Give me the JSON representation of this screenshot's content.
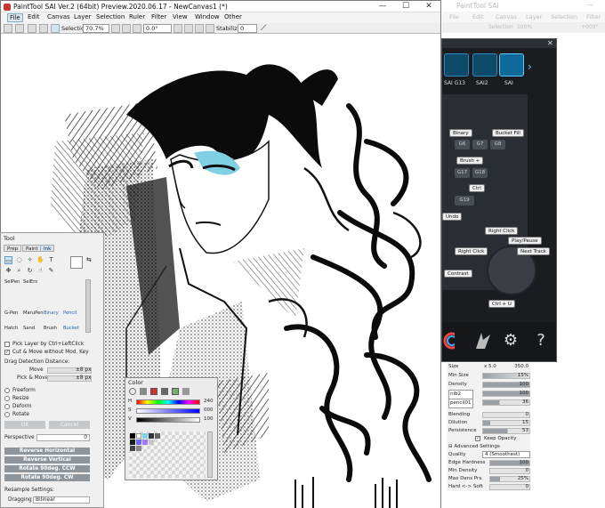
{
  "main_window": {
    "title": "PaintTool SAI Ver.2 (64bit) Preview.2020.06.17 - NewCanvas1 (*)",
    "minimize": "—",
    "maximize": "☐",
    "close": "✕"
  },
  "menu": [
    "File",
    "Edit",
    "Canvas",
    "Layer",
    "Selection",
    "Ruler",
    "Filter",
    "View",
    "Window",
    "Other"
  ],
  "toolbar": {
    "selection_label": "Selection",
    "zoom": "70.7%",
    "rotation": "0.0°",
    "stabilizer_label": "Stabilizer",
    "stabilizer_value": "0"
  },
  "right_ghost": {
    "title": "PaintTool SAI",
    "menu": [
      "File",
      "Edit",
      "Canvas",
      "Layer",
      "Selection",
      "Filter"
    ],
    "selection": "Selection",
    "zoom": "100%",
    "rotation": "+000°"
  },
  "game_panel": {
    "profiles": [
      "SAI G13",
      "SAI2",
      "SAI"
    ],
    "keys": [
      {
        "label": "Binary"
      },
      {
        "label": "Bucket Fill"
      },
      {
        "label": "G6"
      },
      {
        "label": "G7"
      },
      {
        "label": "G8"
      },
      {
        "label": "Brush +"
      },
      {
        "label": "G17"
      },
      {
        "label": "G18"
      },
      {
        "label": "Ctrl"
      },
      {
        "label": "G19"
      },
      {
        "label": "Undo"
      }
    ],
    "stick_labels": {
      "up": "Right Click",
      "play": "Play/Pause",
      "left": "Right Click",
      "right": "Next Track",
      "contrast": "Contrast",
      "down": "Ctrl + U"
    },
    "footer_icons": [
      "color-wheel-icon",
      "logo-icon",
      "gear-icon",
      "help-icon"
    ],
    "help_glyph": "?",
    "gear_glyph": "⚙"
  },
  "brush_settings": {
    "size": {
      "label": "Size",
      "mult": "x 5.0",
      "value": "350.0"
    },
    "min_size": {
      "label": "Min Size",
      "value": "15%"
    },
    "density": {
      "label": "Density",
      "value": "100"
    },
    "shape1": {
      "label": "nib2",
      "value": "100"
    },
    "shape2": {
      "label": "pencil01",
      "value": "36"
    },
    "blending": {
      "label": "Blending",
      "value": "0"
    },
    "dilution": {
      "label": "Dilution",
      "value": "15"
    },
    "persistence": {
      "label": "Persistence",
      "value": "53"
    },
    "keep_opacity": "Keep Opacity",
    "advanced": "Advanced Settings",
    "quality": {
      "label": "Quality",
      "value": "4 (Smoothest)"
    },
    "edge_hardness": {
      "label": "Edge Hardness",
      "value": "100"
    },
    "min_density": {
      "label": "Min Density",
      "value": "0"
    },
    "max_dens_prs": {
      "label": "Max Dens Prs.",
      "value": "25%"
    },
    "hard_soft": {
      "label": "Hard <-> Soft",
      "value": "0"
    }
  },
  "tool_panel": {
    "title": "Tool",
    "tabs": [
      "Prep",
      "Paint",
      "Ink"
    ],
    "brushes_row1": [
      "SelPen",
      "SelErs"
    ],
    "brushes_row2": [
      "G-Pen",
      "MaruPen",
      "Binary",
      "Pencil"
    ],
    "brushes_row3": [
      "Hatch",
      "Sand",
      "Brush",
      "Bucket"
    ],
    "pick_layer": "Pick Layer by Ctrl+LeftClick",
    "cut_move": "Cut & Move without Mod. Key",
    "drag_label": "Drag Detection Distance:",
    "move_label": "Move",
    "move_value": "±8 px",
    "pick_move_label": "Pick & Move",
    "pick_move_value": "±8 px",
    "modes": [
      "Freeform",
      "Resize",
      "Deform",
      "Rotate"
    ],
    "ok": "OK",
    "cancel": "Cancel",
    "perspective_label": "Perspective",
    "perspective_value": "0",
    "reverse_h": "Reverse Horizontal",
    "reverse_v": "Reverse Vertical",
    "rotate_ccw": "Rotate 90deg. CCW",
    "rotate_cw": "Rotate 90deg. CW",
    "resample_label": "Resample Settings:",
    "dragging_label": "Dragging",
    "dragging_value": "Bilinear"
  },
  "color_panel": {
    "title": "Color",
    "h_label": "H",
    "h_value": "240",
    "s_label": "S",
    "s_value": "000",
    "v_label": "V",
    "v_value": "100"
  }
}
